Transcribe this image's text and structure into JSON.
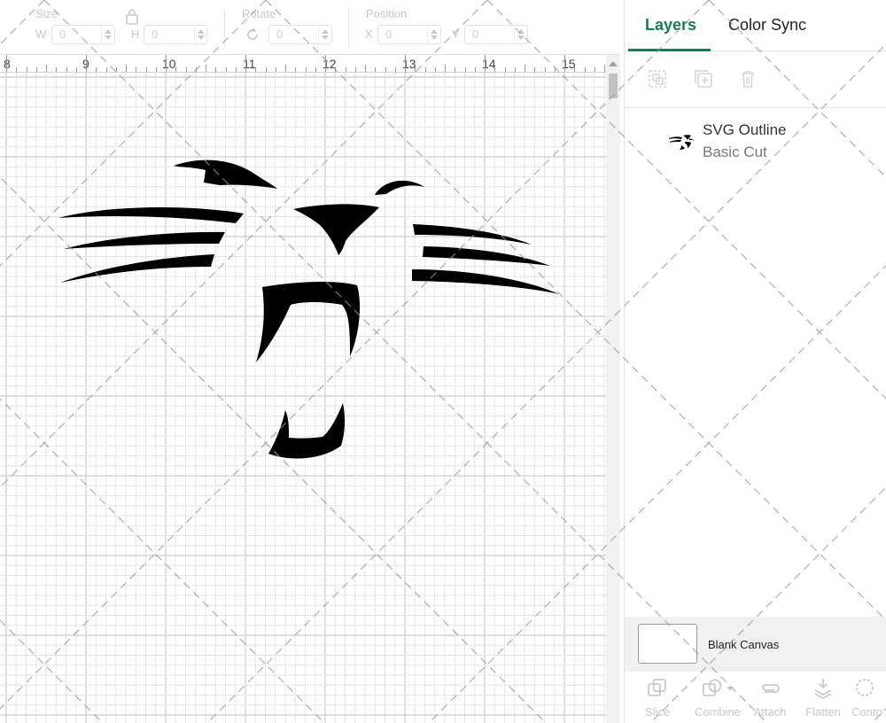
{
  "toolbar": {
    "size_label": "Size",
    "w_label": "W",
    "w_value": "0",
    "h_label": "H",
    "h_value": "0",
    "rotate_label": "Rotate",
    "rotate_value": "0",
    "position_label": "Position",
    "x_label": "X",
    "x_value": "0",
    "y_label": "Y",
    "y_value": "0",
    "lock_icon": "lock-icon",
    "rotate_icon": "rotate-icon"
  },
  "ruler": {
    "numbers": [
      "8",
      "9",
      "10",
      "11",
      "12",
      "13",
      "14",
      "15"
    ]
  },
  "panel": {
    "tabs": [
      {
        "label": "Layers",
        "active": true
      },
      {
        "label": "Color Sync",
        "active": false
      }
    ],
    "layer_tools": [
      "group-icon",
      "duplicate-icon",
      "delete-icon"
    ],
    "layers": [
      {
        "name": "SVG Outline",
        "type": "Basic Cut"
      }
    ],
    "blank_canvas_label": "Blank Canvas",
    "bottom_tools": [
      {
        "label": "Slice",
        "icon": "slice-icon"
      },
      {
        "label": "Combine",
        "icon": "combine-icon"
      },
      {
        "label": "Attach",
        "icon": "attach-icon"
      },
      {
        "label": "Flatten",
        "icon": "flatten-icon"
      },
      {
        "label": "Conto",
        "icon": "contour-icon"
      }
    ]
  },
  "colors": {
    "accent": "#1c7a52",
    "design_fill": "#000000",
    "grid_minor": "#e6e6e6",
    "grid_major": "#cdcdcd"
  }
}
